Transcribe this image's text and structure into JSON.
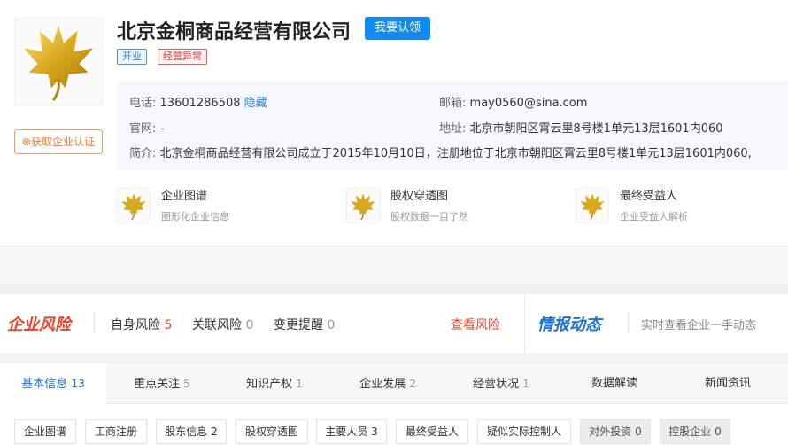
{
  "company": {
    "name": "北京金桐商品经营有限公司",
    "claim_label": "我要认领",
    "tags": [
      "开业",
      "经营异常"
    ],
    "cert_label": "获取企业认证"
  },
  "info": {
    "phone_label": "电话:",
    "phone": "13601286508",
    "hide_label": "隐藏",
    "email_label": "邮箱:",
    "email": "may0560@sina.com",
    "website_label": "官网:",
    "website": "-",
    "address_label": "地址:",
    "address": "北京市朝阳区霄云里8号楼1单元13层1601内060",
    "intro_label": "简介:",
    "intro": "北京金桐商品经营有限公司成立于2015年10月10日，注册地位于北京市朝阳区霄云里8号楼1单元13层1601内060,"
  },
  "features": [
    {
      "title": "企业图谱",
      "sub": "图形化企业信息",
      "icon": "maple-leaf-icon"
    },
    {
      "title": "股权穿透图",
      "sub": "股权数据一目了然",
      "icon": "maple-leaf-icon"
    },
    {
      "title": "最终受益人",
      "sub": "企业受益人解析",
      "icon": "maple-leaf-icon"
    }
  ],
  "risk": {
    "title": "企业风险",
    "items": [
      {
        "label": "自身风险",
        "count": "5"
      },
      {
        "label": "关联风险",
        "count": "0"
      },
      {
        "label": "变更提醒",
        "count": "0"
      }
    ],
    "view_label": "查看风险"
  },
  "intel": {
    "title": "情报动态",
    "sub": "实时查看企业一手动态"
  },
  "tabs": [
    {
      "label": "基本信息",
      "count": "13"
    },
    {
      "label": "重点关注",
      "count": "5"
    },
    {
      "label": "知识产权",
      "count": "1"
    },
    {
      "label": "企业发展",
      "count": "2"
    },
    {
      "label": "经营状况",
      "count": "1"
    },
    {
      "label": "数据解读",
      "count": ""
    },
    {
      "label": "新闻资讯",
      "count": ""
    }
  ],
  "chips": [
    "企业图谱",
    "工商注册",
    "股东信息 2",
    "股权穿透图",
    "主要人员 3",
    "最终受益人",
    "疑似实际控制人",
    "对外投资 0",
    "控股企业 0"
  ],
  "colors": {
    "accent": "#128bed",
    "risk": "#e8432a",
    "intel": "#1c6fd3",
    "gold": "#d4a017"
  }
}
